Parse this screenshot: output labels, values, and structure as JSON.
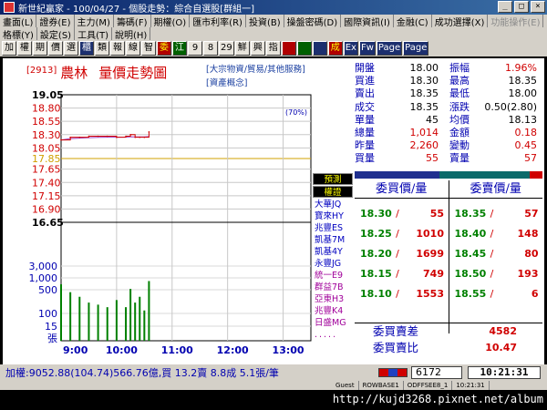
{
  "window": {
    "title": "新世紀贏家 - 100/04/27 - 個股走勢：綜合自選股[群組一]",
    "buttons": [
      "_",
      "□",
      "×"
    ]
  },
  "menu_row1": [
    "畫面(L)",
    "證券(E)",
    "主力(M)",
    "籌碼(F)",
    "期權(O)",
    "匯市利率(R)",
    "投資(B)",
    "操盤密碼(D)",
    "國際資訊(I)",
    "金融(C)",
    "成功選擇(X)",
    "功能操作(E)"
  ],
  "menu_row2": [
    "格標(Y)",
    "設定(S)",
    "工具(T)",
    "說明(H)"
  ],
  "toolbar": [
    "加",
    "權",
    "期",
    "價",
    "選",
    "櫃",
    "類",
    "報",
    "線",
    "智",
    "委",
    "江",
    "9",
    "8",
    "29",
    "鮮",
    "興",
    "指",
    "",
    "",
    "",
    "成",
    "Ex",
    "Fw",
    "Page",
    "Page"
  ],
  "stock": {
    "code": "[2913]",
    "name": "農林",
    "chart_title": "量價走勢圖",
    "sector_line1": "[大宗物資/貿易/其他服務]",
    "sector_line2": "[資產概念]"
  },
  "chart": {
    "price_label_unit": "(70%)",
    "price_axis": [
      {
        "label": "19.05",
        "color": "#000000",
        "bold": true
      },
      {
        "label": "18.80",
        "color": "#d00000"
      },
      {
        "label": "18.55",
        "color": "#d00000"
      },
      {
        "label": "18.30",
        "color": "#d00000"
      },
      {
        "label": "18.05",
        "color": "#d00000"
      },
      {
        "label": "17.85",
        "color": "#d0a000"
      },
      {
        "label": "17.65",
        "color": "#d00000"
      },
      {
        "label": "17.40",
        "color": "#d00000"
      },
      {
        "label": "17.15",
        "color": "#d00000"
      },
      {
        "label": "16.90",
        "color": "#d00000"
      },
      {
        "label": "16.65",
        "color": "#000000",
        "bold": true
      }
    ],
    "volume_axis": [
      "3,000",
      "1,000",
      "500",
      "100",
      "15",
      "張"
    ],
    "time_labels": [
      "9:00",
      "10:00",
      "11:00",
      "12:00",
      "13:00"
    ]
  },
  "chart_data": {
    "type": "line",
    "title": "量價走勢圖",
    "xlabel": "",
    "ylabel": "",
    "x": [
      "9:00",
      "9:10",
      "9:20",
      "9:30",
      "9:40",
      "9:50",
      "10:00",
      "10:10",
      "10:15",
      "10:20",
      "10:25",
      "10:30",
      "10:35"
    ],
    "series": [
      {
        "name": "",
        "values": [
          18.2,
          18.25,
          18.25,
          18.27,
          18.27,
          18.27,
          18.25,
          18.27,
          18.3,
          18.25,
          18.25,
          18.25,
          18.35
        ]
      }
    ],
    "reference_price": 17.85,
    "ylim": [
      16.65,
      19.05
    ],
    "volume": [
      600,
      300,
      200,
      120,
      100,
      80,
      150,
      80,
      400,
      120,
      200,
      60,
      800
    ],
    "volume_axis_scale": "log",
    "grid": true,
    "xlim": [
      "9:00",
      "13:30"
    ]
  },
  "side_list": {
    "header1": "預測",
    "header2": "權證",
    "items": [
      "大華JQ",
      "寶來HY",
      "兆豐ES",
      "凱基7M",
      "凱基4Y",
      "永豐JG",
      "統一E9",
      "群益7B",
      "亞東H3",
      "兆豐K4",
      "日盛MG",
      "....."
    ]
  },
  "quote": {
    "rows": [
      {
        "l1": "開盤",
        "v1": "18.00",
        "c1": "blk",
        "l2": "振幅",
        "v2": "1.96%",
        "c2": "red"
      },
      {
        "l1": "買進",
        "v1": "18.30",
        "c1": "blk",
        "l2": "最高",
        "v2": "18.35",
        "c2": "blk"
      },
      {
        "l1": "賣出",
        "v1": "18.35",
        "c1": "blk",
        "l2": "最低",
        "v2": "18.00",
        "c2": "blk"
      },
      {
        "l1": "成交",
        "v1": "18.35",
        "c1": "blk",
        "l2": "漲跌",
        "v2": "0.50(2.80)",
        "c2": "blk"
      },
      {
        "l1": "單量",
        "v1": "45",
        "c1": "blk",
        "l2": "均價",
        "v2": "18.13",
        "c2": "blk"
      },
      {
        "l1": "總量",
        "v1": "1,014",
        "c1": "red",
        "l2": "金額",
        "v2": "0.18",
        "c2": "red"
      },
      {
        "l1": "昨量",
        "v1": "2,260",
        "c1": "red",
        "l2": "變動",
        "v2": "0.45",
        "c2": "red"
      },
      {
        "l1": "買量",
        "v1": "55",
        "c1": "red",
        "l2": "賣量",
        "v2": "57",
        "c2": "red"
      }
    ]
  },
  "order_book": {
    "bid_header": "委買價/量",
    "ask_header": "委賣價/量",
    "bids": [
      {
        "price": "18.30",
        "vol": "55"
      },
      {
        "price": "18.25",
        "vol": "1010"
      },
      {
        "price": "18.20",
        "vol": "1699"
      },
      {
        "price": "18.15",
        "vol": "749"
      },
      {
        "price": "18.10",
        "vol": "1553"
      }
    ],
    "asks": [
      {
        "price": "18.35",
        "vol": "57"
      },
      {
        "price": "18.40",
        "vol": "148"
      },
      {
        "price": "18.45",
        "vol": "80"
      },
      {
        "price": "18.50",
        "vol": "193"
      },
      {
        "price": "18.55",
        "vol": "6"
      }
    ],
    "bid_fraction": 0.45
  },
  "summary": {
    "diff_label": "委買賣差",
    "diff_value": "4582",
    "ratio_label": "委買賣比",
    "ratio_value": "10.47"
  },
  "status": {
    "ticker": "加權:9052.88(104.74)566.76億,買 13.2賣 8.8成 5.1張/筆",
    "input_value": "6172",
    "clock": "10:21:31",
    "bar_user": "Guest",
    "bar_a": "ROWBASE1",
    "bar_b": "ODFFSEE8_1",
    "bar_time": "10:21:31"
  },
  "watermark": "http://kujd3268.pixnet.net/album"
}
